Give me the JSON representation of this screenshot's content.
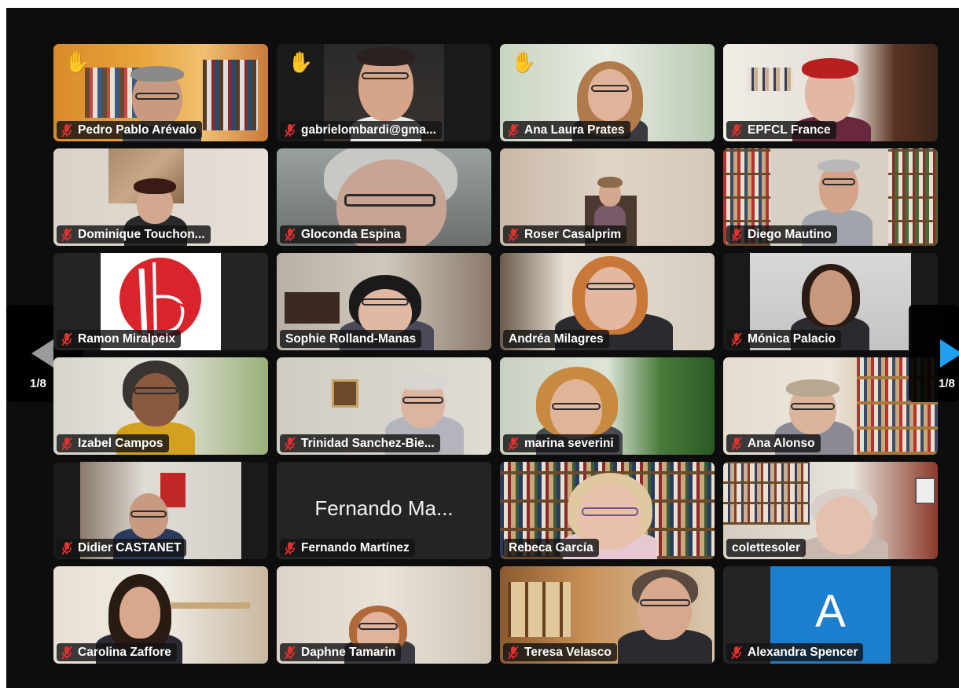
{
  "pagination": {
    "left_label": "1/8",
    "right_label": "1/8"
  },
  "colors": {
    "active_speaker_border": "#27d03a",
    "muted_icon": "#e0312f",
    "nav_arrow_right": "#1ea0f0",
    "nav_arrow_left": "#9a9a9a"
  },
  "participants": [
    {
      "name": "Pedro Pablo Arévalo",
      "hand_raised": true,
      "muted": true
    },
    {
      "name": "gabrielombardi@gma...",
      "hand_raised": true,
      "muted": true
    },
    {
      "name": "Ana Laura Prates",
      "hand_raised": true,
      "muted": true
    },
    {
      "name": "EPFCL France",
      "hand_raised": false,
      "muted": true
    },
    {
      "name": "Dominique Touchon...",
      "hand_raised": false,
      "muted": true
    },
    {
      "name": "Gloconda Espina",
      "hand_raised": false,
      "muted": true
    },
    {
      "name": "Roser Casalprim",
      "hand_raised": false,
      "muted": true
    },
    {
      "name": "Diego Mautino",
      "hand_raised": false,
      "muted": true
    },
    {
      "name": "Ramon Miralpeix",
      "hand_raised": false,
      "muted": true
    },
    {
      "name": "Sophie Rolland-Manas",
      "hand_raised": false,
      "muted": false,
      "active_speaker": true
    },
    {
      "name": "Andréa Milagres",
      "hand_raised": false,
      "muted": false
    },
    {
      "name": "Mónica Palacio",
      "hand_raised": false,
      "muted": true
    },
    {
      "name": "Izabel Campos",
      "hand_raised": false,
      "muted": true
    },
    {
      "name": "Trinidad Sanchez-Bie...",
      "hand_raised": false,
      "muted": true
    },
    {
      "name": "marina severini",
      "hand_raised": false,
      "muted": true
    },
    {
      "name": "Ana Alonso",
      "hand_raised": false,
      "muted": true
    },
    {
      "name": "Didier CASTANET",
      "hand_raised": false,
      "muted": true
    },
    {
      "name": "Fernando Martínez",
      "hand_raised": false,
      "muted": true,
      "video_off_label": "Fernando Ma..."
    },
    {
      "name": "Rebeca García",
      "hand_raised": false,
      "muted": false
    },
    {
      "name": "colettesoler",
      "hand_raised": false,
      "muted": false
    },
    {
      "name": "Carolina Zaffore",
      "hand_raised": false,
      "muted": true
    },
    {
      "name": "Daphne Tamarin",
      "hand_raised": false,
      "muted": true
    },
    {
      "name": "Teresa Velasco",
      "hand_raised": false,
      "muted": true
    },
    {
      "name": "Alexandra Spencer",
      "hand_raised": false,
      "muted": true,
      "avatar_letter": "A"
    }
  ]
}
